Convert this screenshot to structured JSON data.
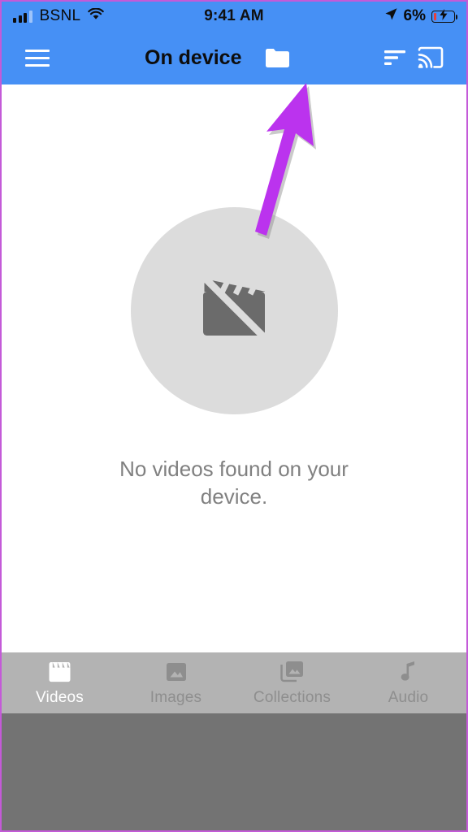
{
  "status_bar": {
    "carrier": "BSNL",
    "signal_icon": "signal-bars-icon",
    "wifi_icon": "wifi-icon",
    "time": "9:41 AM",
    "location_icon": "location-arrow-icon",
    "battery_percent": "6%",
    "battery_icon": "battery-charging-icon"
  },
  "app_bar": {
    "menu_icon": "hamburger-menu-icon",
    "title": "On device",
    "folder_icon": "folder-icon",
    "sort_icon": "sort-icon",
    "cast_icon": "cast-icon"
  },
  "empty_state": {
    "icon": "no-video-clapperboard-icon",
    "message": "No videos found on your device."
  },
  "annotation": {
    "arrow_icon": "arrow-pointing-to-folder-icon",
    "color": "#bb33ee",
    "points_at": "folder-icon"
  },
  "bottom_nav": {
    "items": [
      {
        "label": "Videos",
        "icon": "clapperboard-icon",
        "active": true
      },
      {
        "label": "Images",
        "icon": "image-icon",
        "active": false
      },
      {
        "label": "Collections",
        "icon": "collections-icon",
        "active": false
      },
      {
        "label": "Audio",
        "icon": "music-note-icon",
        "active": false
      }
    ]
  },
  "colors": {
    "app_bar_blue": "#4690f5",
    "nav_bar_gray": "#b3b3b3",
    "letterbox_gray": "#737373",
    "empty_circle_gray": "#dcdcdc",
    "empty_icon_gray": "#6b6b6b",
    "empty_text_gray": "#808080",
    "annotation_purple": "#bb33ee",
    "screenshot_border": "#c45ad8"
  }
}
